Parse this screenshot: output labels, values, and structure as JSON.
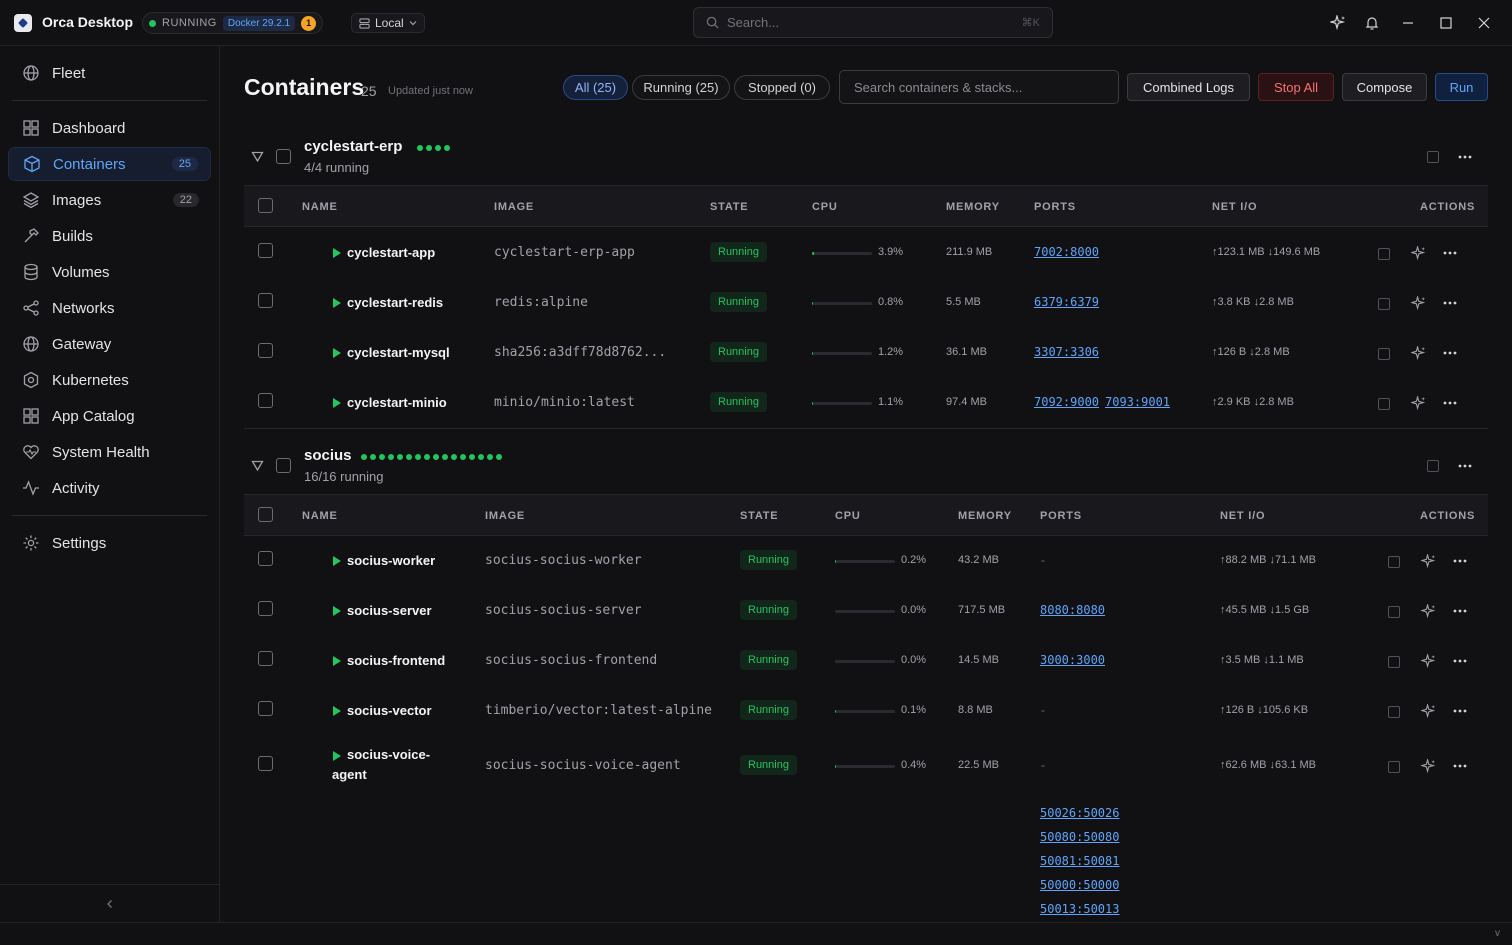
{
  "app": {
    "title": "Orca Desktop",
    "engine_status": "RUNNING",
    "docker_version": "Docker 29.2.1",
    "notifications": "1",
    "context": "Local"
  },
  "global_search": {
    "placeholder": "Search...",
    "shortcut": "⌘K"
  },
  "sidebar": {
    "items": [
      {
        "label": "Fleet",
        "icon": "globe-icon"
      },
      {
        "label": "Dashboard",
        "icon": "grid-icon"
      },
      {
        "label": "Containers",
        "icon": "box-icon",
        "count": "25",
        "active": true
      },
      {
        "label": "Images",
        "icon": "layers-icon",
        "count": "22"
      },
      {
        "label": "Builds",
        "icon": "hammer-icon"
      },
      {
        "label": "Volumes",
        "icon": "database-icon"
      },
      {
        "label": "Networks",
        "icon": "share-icon"
      },
      {
        "label": "Gateway",
        "icon": "globe-icon"
      },
      {
        "label": "Kubernetes",
        "icon": "hexagon-icon"
      },
      {
        "label": "App Catalog",
        "icon": "grid-icon"
      },
      {
        "label": "System Health",
        "icon": "heart-icon"
      },
      {
        "label": "Activity",
        "icon": "activity-icon"
      },
      {
        "label": "Settings",
        "icon": "gear-icon"
      }
    ]
  },
  "page": {
    "title": "Containers",
    "count": "25",
    "updated": "Updated just now",
    "filters": {
      "all": "All (25)",
      "running": "Running (25)",
      "stopped": "Stopped (0)"
    },
    "search_placeholder": "Search containers & stacks...",
    "buttons": {
      "combined_logs": "Combined Logs",
      "stop_all": "Stop All",
      "compose": "Compose",
      "run": "Run"
    }
  },
  "columns": {
    "name": "NAME",
    "image": "IMAGE",
    "state": "STATE",
    "cpu": "CPU",
    "memory": "MEMORY",
    "ports": "PORTS",
    "net_io": "NET I/O",
    "actions": "ACTIONS"
  },
  "stacks": [
    {
      "name": "cyclestart-erp",
      "running_text": "4/4 running",
      "containers": [
        {
          "name": "cyclestart-app",
          "image": "cyclestart-erp-app",
          "state": "Running",
          "cpu": "3.9%",
          "cpu_pct": 3.9,
          "memory": "211.9 MB",
          "ports": [
            "7002:8000"
          ],
          "net": "↑123.1 MB ↓149.6 MB"
        },
        {
          "name": "cyclestart-redis",
          "image": "redis:alpine",
          "state": "Running",
          "cpu": "0.8%",
          "cpu_pct": 0.8,
          "memory": "5.5 MB",
          "ports": [
            "6379:6379"
          ],
          "net": "↑3.8 KB ↓2.8 MB"
        },
        {
          "name": "cyclestart-mysql",
          "image": "sha256:a3dff78d8762...",
          "state": "Running",
          "cpu": "1.2%",
          "cpu_pct": 1.2,
          "memory": "36.1 MB",
          "ports": [
            "3307:3306"
          ],
          "net": "↑126 B ↓2.8 MB"
        },
        {
          "name": "cyclestart-minio",
          "image": "minio/minio:latest",
          "state": "Running",
          "cpu": "1.1%",
          "cpu_pct": 1.1,
          "memory": "97.4 MB",
          "ports": [
            "7092:9000",
            "7093:9001"
          ],
          "net": "↑2.9 KB ↓2.8 MB"
        }
      ]
    },
    {
      "name": "socius",
      "running_text": "16/16 running",
      "containers": [
        {
          "name": "socius-worker",
          "image": "socius-socius-worker",
          "state": "Running",
          "cpu": "0.2%",
          "cpu_pct": 0.2,
          "memory": "43.2 MB",
          "ports": [],
          "net": "↑88.2 MB ↓71.1 MB"
        },
        {
          "name": "socius-server",
          "image": "socius-socius-server",
          "state": "Running",
          "cpu": "0.0%",
          "cpu_pct": 0.0,
          "memory": "717.5 MB",
          "ports": [
            "8080:8080"
          ],
          "net": "↑45.5 MB ↓1.5 GB"
        },
        {
          "name": "socius-frontend",
          "image": "socius-socius-frontend",
          "state": "Running",
          "cpu": "0.0%",
          "cpu_pct": 0.0,
          "memory": "14.5 MB",
          "ports": [
            "3000:3000"
          ],
          "net": "↑3.5 MB ↓1.1 MB"
        },
        {
          "name": "socius-vector",
          "image": "timberio/vector:latest-alpine",
          "state": "Running",
          "cpu": "0.1%",
          "cpu_pct": 0.1,
          "memory": "8.8 MB",
          "ports": [],
          "net": "↑126 B ↓105.6 KB"
        },
        {
          "name": "socius-voice-\nagent",
          "image": "socius-socius-voice-agent",
          "state": "Running",
          "cpu": "0.4%",
          "cpu_pct": 0.4,
          "memory": "22.5 MB",
          "ports": [],
          "net": "↑62.6 MB ↓63.1 MB"
        }
      ],
      "overflow_ports": [
        "50026:50026",
        "50080:50080",
        "50081:50081",
        "50000:50000",
        "50013:50013"
      ]
    }
  ],
  "empty_port": "-",
  "footer": {
    "version": "v"
  }
}
